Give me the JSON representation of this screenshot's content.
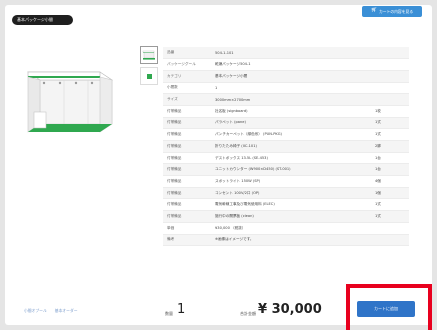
{
  "header": {
    "cart_button_label": "カートの内容を見る",
    "page_title": "基本パッケージ小間"
  },
  "specs": [
    {
      "key": "品番",
      "value": "504-1-101",
      "qty": ""
    },
    {
      "key": "パッケージグール",
      "value": "乾燥パッケージ504-1",
      "qty": ""
    },
    {
      "key": "カテゴリ",
      "value": "基本パッケージ小間",
      "qty": ""
    },
    {
      "key": "小間数",
      "value": "1",
      "qty": ""
    },
    {
      "key": "サイズ",
      "value": "3000mm×2700mm",
      "qty": ""
    },
    {
      "key": "付帯備品",
      "value": "社名板 (signboard)",
      "qty": "1枚"
    },
    {
      "key": "付帯備品",
      "value": "パラペット (pane)",
      "qty": "1式"
    },
    {
      "key": "付帯備品",
      "value": "パンチカーペット（緑色系） (PUN-PKG)",
      "qty": "1式"
    },
    {
      "key": "付帯備品",
      "value": "折りたたみ椅子 (IIC-101)",
      "qty": "2脚"
    },
    {
      "key": "付帯備品",
      "value": "デストボックス 13.5L (SE-453)",
      "qty": "1台"
    },
    {
      "key": "付帯備品",
      "value": "ユニットカウンター (W900×D450) (ST-001)",
      "qty": "1台"
    },
    {
      "key": "付帯備品",
      "value": "スポットライト 150W (SP)",
      "qty": "4個"
    },
    {
      "key": "付帯備品",
      "value": "コンセント 100V/2口 (OP)",
      "qty": "1個"
    },
    {
      "key": "付帯備品",
      "value": "電気幹線工事及び電気使用料 (ELEC)",
      "qty": "1式"
    },
    {
      "key": "付帯備品",
      "value": "施行中の開票板 (clean)",
      "qty": "1式"
    },
    {
      "key": "単価",
      "value": "¥30,000 （税抜）",
      "qty": ""
    },
    {
      "key": "備考",
      "value": "※画像はイメージです。",
      "qty": ""
    }
  ],
  "footer": {
    "link1": "小間オプール",
    "link2": "基本オーダー",
    "qty_label": "数量",
    "qty_value": "1",
    "total_label": "合計金額",
    "total_value": "¥ 30,000",
    "add_button_label": "カートに追加"
  },
  "colors": {
    "accent": "#2f74c8",
    "highlight": "#e8001e",
    "booth_green": "#2fa84f"
  }
}
